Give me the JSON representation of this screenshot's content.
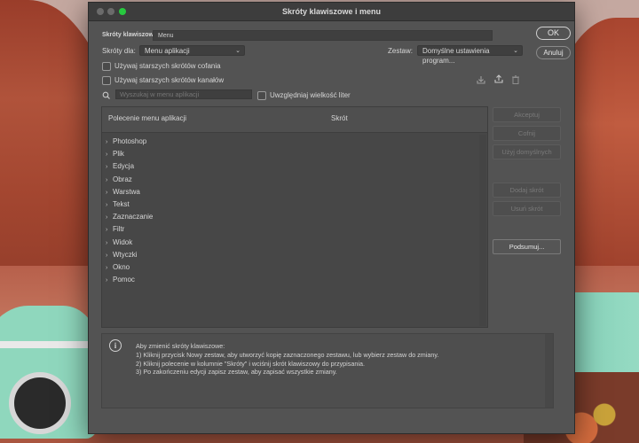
{
  "dialog": {
    "title": "Skróty klawiszowe i menu",
    "set_name_label": "Skróty klawiszowe",
    "set_name_value": "Menu",
    "ok_label": "OK",
    "cancel_label": "Anuluj",
    "shortcuts_for_label": "Skróty dla:",
    "shortcuts_for_value": "Menu aplikacji",
    "set_label": "Zestaw:",
    "set_value": "Domyślne ustawienia program...",
    "legacy_undo_label": "Używaj starszych skrótów cofania",
    "legacy_channel_label": "Używaj starszych skrótów kanałów",
    "search_placeholder": "Wyszukaj w menu aplikacji",
    "match_case_label": "Uwzględniaj wielkość liter",
    "columns": {
      "command": "Polecenie menu aplikacji",
      "shortcut": "Skrót"
    },
    "menu_items": [
      "Photoshop",
      "Plik",
      "Edycja",
      "Obraz",
      "Warstwa",
      "Tekst",
      "Zaznaczanie",
      "Filtr",
      "Widok",
      "Wtyczki",
      "Okno",
      "Pomoc"
    ],
    "side_buttons": {
      "accept": "Akceptuj",
      "undo": "Cofnij",
      "use_default": "Użyj domyślnych",
      "add_shortcut": "Dodaj skrót",
      "remove_shortcut": "Usuń skrót",
      "summarize": "Podsumuj..."
    },
    "info": {
      "line1": "Aby zmienić skróty klawiszowe:",
      "line2": "1) Kliknij przycisk Nowy zestaw, aby utworzyć kopię zaznaczonego zestawu, lub wybierz zestaw do zmiany.",
      "line3": "2) Kliknij polecenie w kolumnie \"Skróty\" i wciśnij skrót klawiszowy do przypisania.",
      "line4": "3) Po zakończeniu edycji zapisz zestaw, aby zapisać wszystkie zmiany."
    },
    "icons": {
      "save_set": "save-set-icon",
      "new_set": "new-set-icon",
      "delete_set": "trash-icon",
      "search": "search-icon",
      "info": "info-icon"
    }
  }
}
